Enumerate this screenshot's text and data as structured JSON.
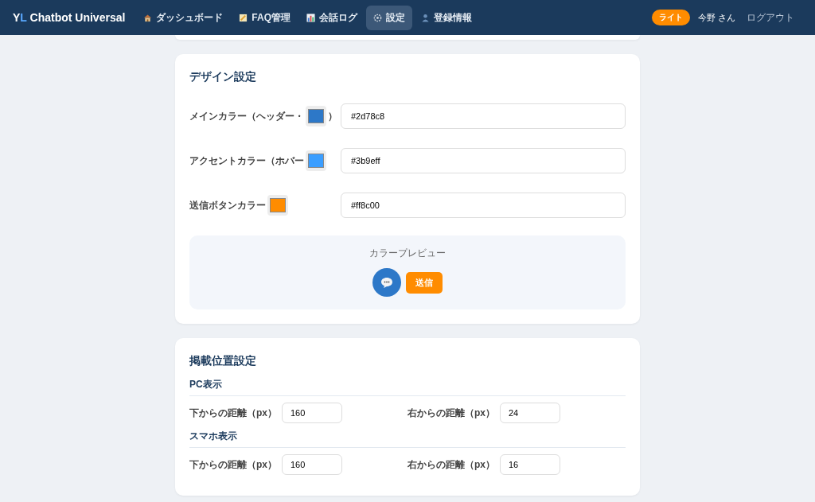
{
  "header": {
    "brand_y": "Y",
    "brand_l": "L",
    "brand_rest": "Chatbot Universal",
    "nav": [
      {
        "label": "ダッシュボード",
        "selected": false
      },
      {
        "label": "FAQ管理",
        "selected": false
      },
      {
        "label": "会話ログ",
        "selected": false
      },
      {
        "label": "設定",
        "selected": true
      },
      {
        "label": "登録情報",
        "selected": false
      }
    ],
    "plan_badge": "ライト",
    "user": "今野 さん",
    "logout": "ログアウト"
  },
  "design": {
    "title": "デザイン設定",
    "colors": [
      {
        "label": "メインカラー（ヘッダー・",
        "label_end": "）",
        "color": "#2d78c8",
        "value": "#2d78c8"
      },
      {
        "label": "アクセントカラー（ホバー",
        "color": "#3b9eff",
        "value": "#3b9eff"
      },
      {
        "label": "送信ボタンカラー",
        "color": "#ff8c00",
        "value": "#ff8c00"
      }
    ],
    "preview": {
      "title": "カラープレビュー",
      "send_button": "送信"
    }
  },
  "position": {
    "title": "掲載位置設定",
    "groups": [
      {
        "title": "PC表示",
        "fields": [
          {
            "label": "下からの距離（px）",
            "value": "160"
          },
          {
            "label": "右からの距離（px）",
            "value": "24"
          }
        ]
      },
      {
        "title": "スマホ表示",
        "fields": [
          {
            "label": "下からの距離（px）",
            "value": "160"
          },
          {
            "label": "右からの距離（px）",
            "value": "16"
          }
        ]
      }
    ]
  }
}
